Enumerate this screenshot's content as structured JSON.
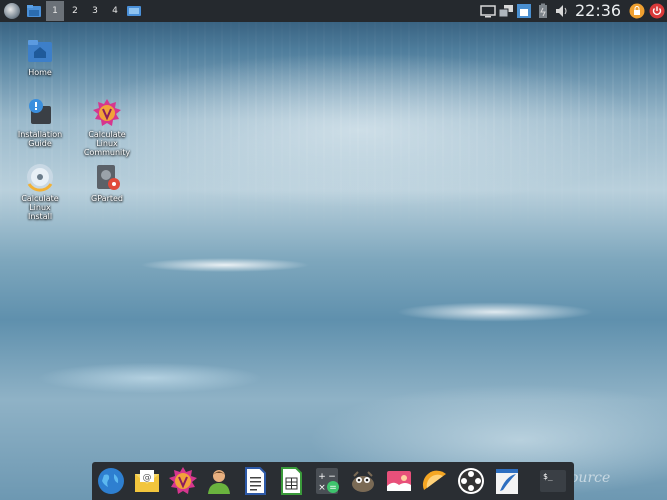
{
  "panel": {
    "workspaces": [
      "1",
      "2",
      "3",
      "4"
    ],
    "active_workspace": "1",
    "clock": "22:36"
  },
  "desktop_icons": [
    {
      "label_lines": [
        "Home"
      ]
    },
    {
      "label_lines": [
        "Installation",
        "Guide"
      ]
    },
    {
      "label_lines": [
        "Calculate Linux",
        "Community"
      ]
    },
    {
      "label_lines": [
        "Calculate Linux",
        "Install"
      ]
    },
    {
      "label_lines": [
        "GParted"
      ]
    }
  ],
  "dock": {
    "apps": [
      "browser-icon",
      "mail-icon",
      "calculate-community-icon",
      "contacts-icon",
      "writer-document-icon",
      "spreadsheet-icon",
      "calculator-icon",
      "gimp-icon",
      "image-viewer-icon",
      "slice-app-icon",
      "media-player-icon",
      "text-editor-icon",
      "terminal-icon"
    ]
  },
  "wallpaper_watermark": "ource",
  "colors": {
    "panel_bg": "#25292e",
    "dock_bg": "#2a2e33",
    "active_workspace_bg": "#6b7178",
    "power_orange": "#f0a030",
    "power_red": "#d93a3a"
  }
}
